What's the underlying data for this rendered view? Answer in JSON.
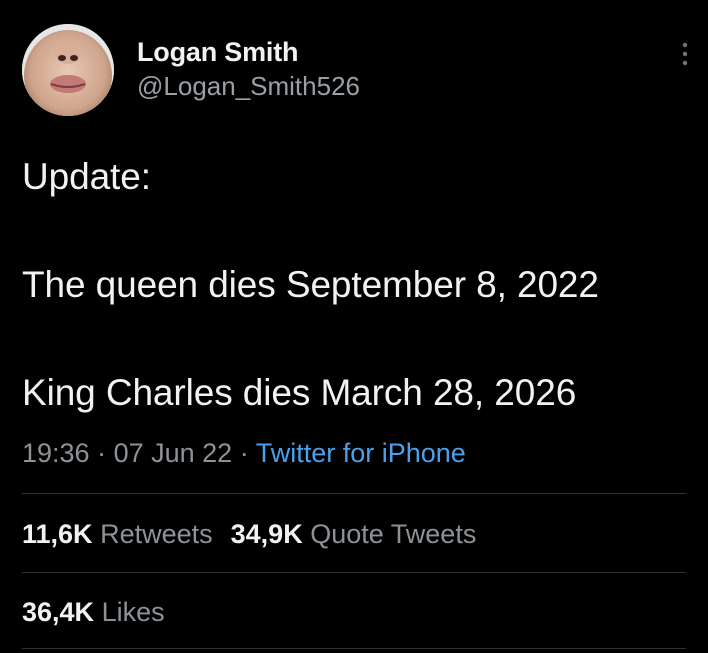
{
  "author": {
    "display_name": "Logan Smith",
    "handle": "@Logan_Smith526"
  },
  "tweet": {
    "lines": [
      "Update:",
      "The queen dies September 8, 2022",
      "King Charles dies March 28, 2026"
    ]
  },
  "meta": {
    "time": "19:36",
    "sep1": " · ",
    "date": "07 Jun 22",
    "sep2": " · ",
    "source": "Twitter for iPhone"
  },
  "stats": {
    "retweets": {
      "count": "11,6K",
      "label": "Retweets"
    },
    "quote_tweets": {
      "count": "34,9K",
      "label": "Quote Tweets"
    },
    "likes": {
      "count": "36,4K",
      "label": "Likes"
    }
  },
  "icons": {
    "more": "more-vertical-icon"
  },
  "colors": {
    "background": "#000000",
    "text": "#f2f2f2",
    "muted": "#8d9297",
    "link": "#4aa0ea",
    "divider": "#2f3336"
  }
}
